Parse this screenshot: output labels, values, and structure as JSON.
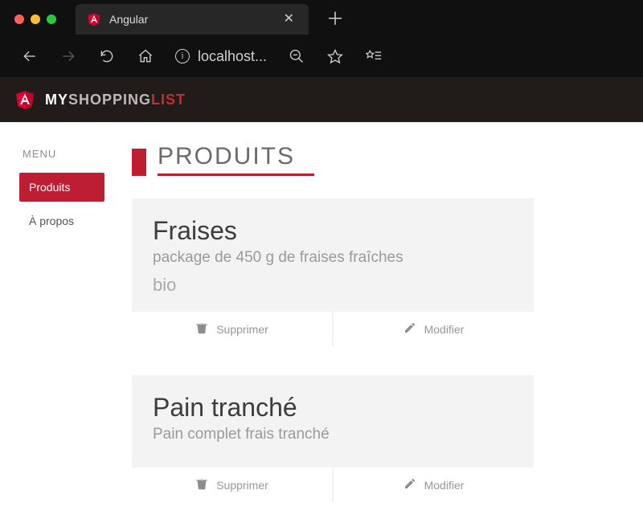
{
  "browser": {
    "tab": {
      "title": "Angular"
    },
    "url": "localhost..."
  },
  "appbar": {
    "brand": {
      "part1": "MY",
      "part2": "SHOPPING",
      "part3": "LIST"
    }
  },
  "sidebar": {
    "heading": "MENU",
    "items": [
      {
        "label": "Produits",
        "active": true
      },
      {
        "label": "À propos",
        "active": false
      }
    ]
  },
  "page": {
    "title": "PRODUITS"
  },
  "products": [
    {
      "name": "Fraises",
      "description": "package de 450 g de fraises fraîches",
      "tag": "bio",
      "actions": {
        "delete": "Supprimer",
        "edit": "Modifier"
      }
    },
    {
      "name": "Pain tranché",
      "description": "Pain complet frais tranché",
      "tag": "",
      "actions": {
        "delete": "Supprimer",
        "edit": "Modifier"
      }
    }
  ],
  "colors": {
    "brand_red": "#c22d36",
    "brand_red_2": "#be1e33",
    "appbar_bg": "#211b19"
  }
}
